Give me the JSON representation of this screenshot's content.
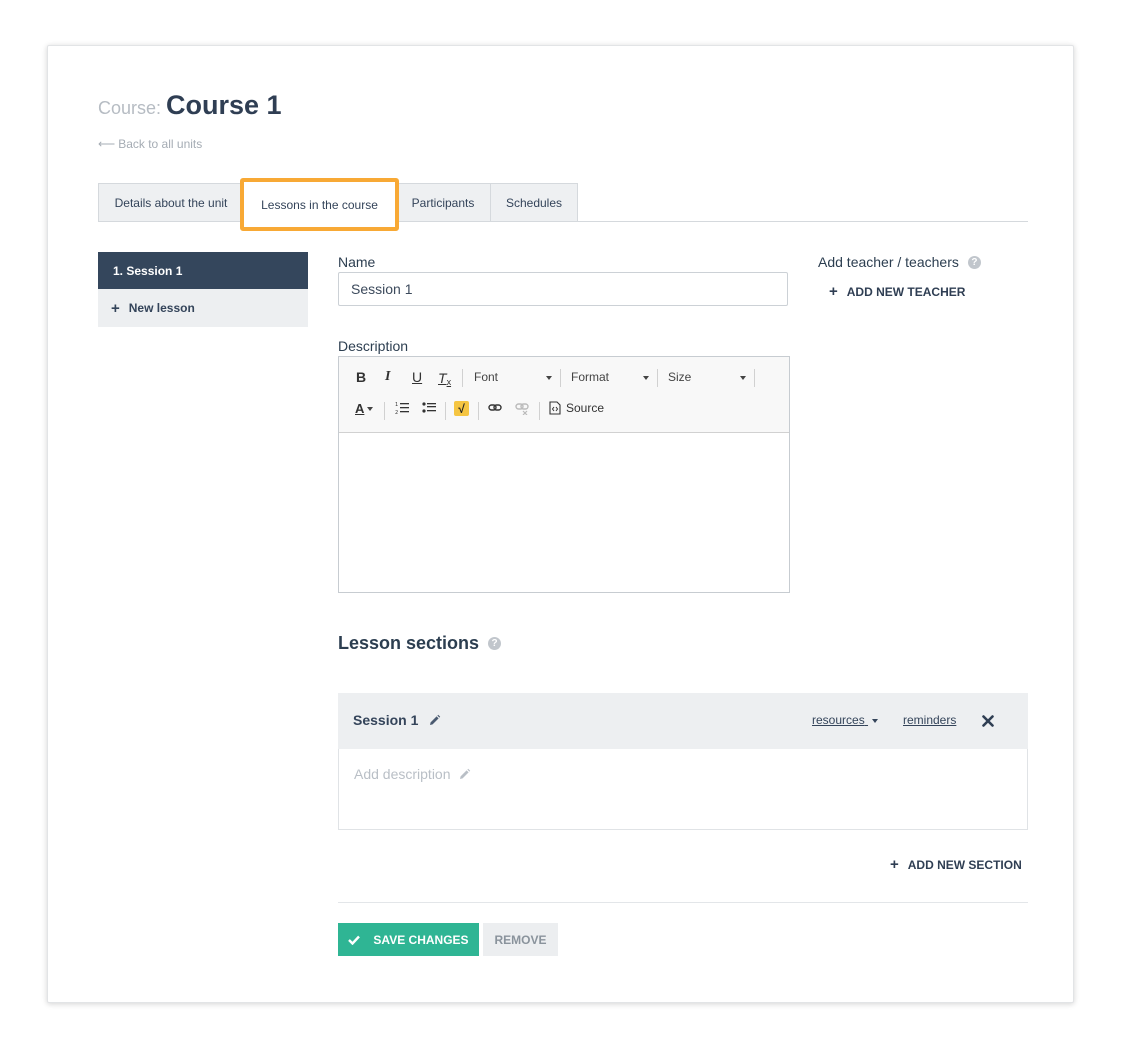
{
  "header": {
    "prefix": "Course:",
    "title": "Course 1",
    "back_link": "Back to all units"
  },
  "tabs": [
    {
      "label": "Details about the unit"
    },
    {
      "label": "Lessons in the course"
    },
    {
      "label": "Participants"
    },
    {
      "label": "Schedules"
    }
  ],
  "active_tab": "Lessons in the course",
  "sidebar": {
    "active_lesson": "1. Session 1",
    "new_lesson": "New lesson"
  },
  "form": {
    "name_label": "Name",
    "name_value": "Session 1",
    "teacher_label": "Add teacher / teachers",
    "add_teacher": "ADD NEW TEACHER",
    "description_label": "Description"
  },
  "editor_toolbar": {
    "bold": "B",
    "italic": "I",
    "underline": "U",
    "remove_format": "T",
    "font": "Font",
    "format": "Format",
    "size": "Size",
    "source": "Source"
  },
  "sections": {
    "title": "Lesson sections",
    "items": [
      {
        "name": "Session 1",
        "resources": "resources",
        "reminders": "reminders",
        "description_placeholder": "Add description"
      }
    ],
    "add_section": "ADD NEW SECTION"
  },
  "actions": {
    "save": "SAVE CHANGES",
    "remove": "REMOVE"
  },
  "colors": {
    "highlight": "#f8a935",
    "primary": "#34465c",
    "success": "#2fb594"
  }
}
